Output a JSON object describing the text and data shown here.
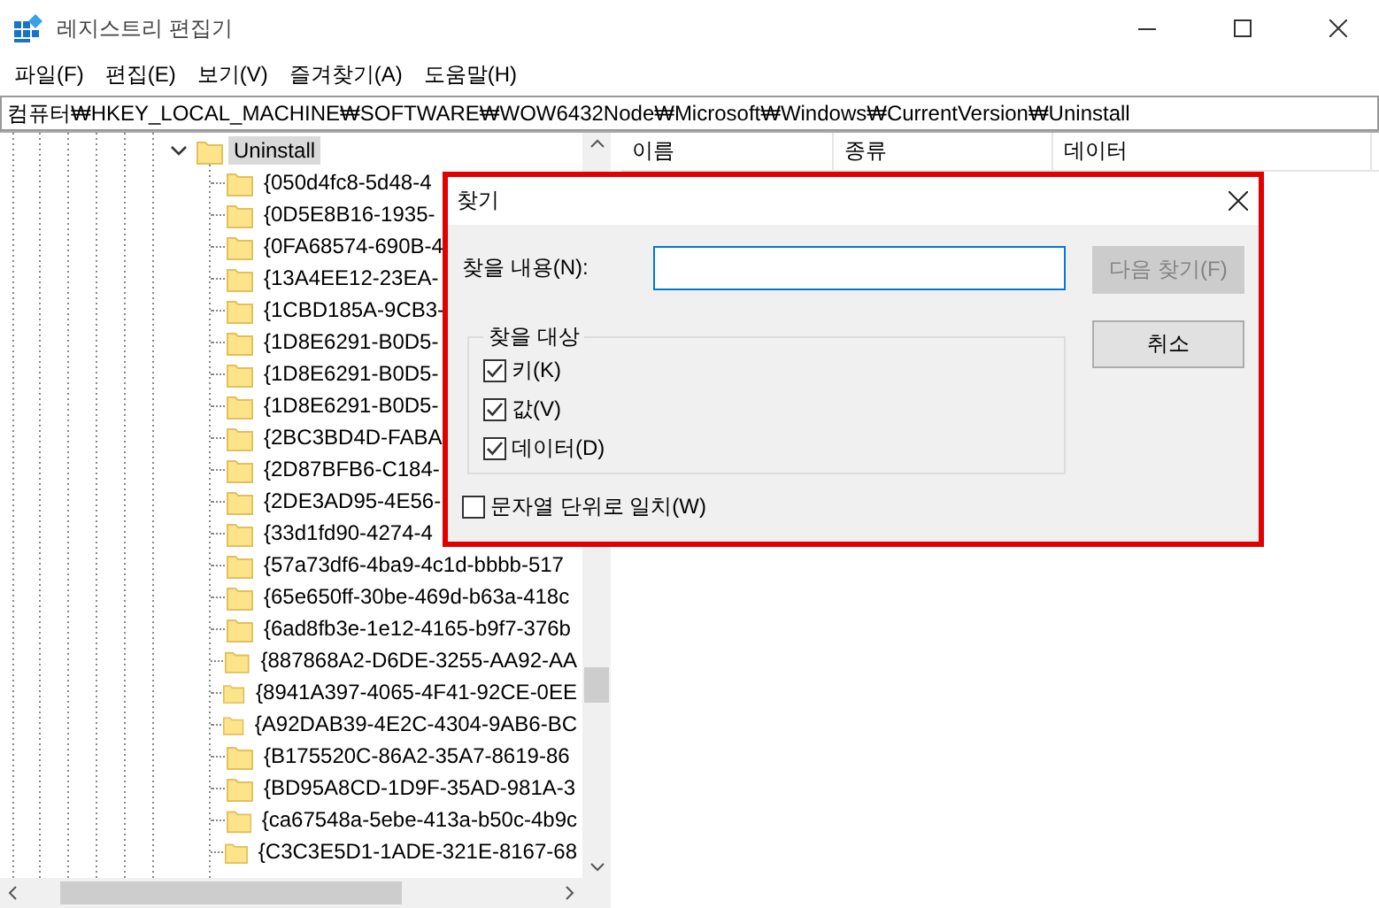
{
  "window": {
    "title": "레지스트리 편집기"
  },
  "menu": [
    {
      "label": "파일(F)"
    },
    {
      "label": "편집(E)"
    },
    {
      "label": "보기(V)"
    },
    {
      "label": "즐겨찾기(A)"
    },
    {
      "label": "도움말(H)"
    }
  ],
  "address": "컴퓨터₩HKEY_LOCAL_MACHINE₩SOFTWARE₩WOW6432Node₩Microsoft₩Windows₩CurrentVersion₩Uninstall",
  "tree": {
    "label": "Uninstall",
    "expanded": true,
    "selected": true,
    "children": [
      {
        "label": "{050d4fc8-5d48-4"
      },
      {
        "label": "{0D5E8B16-1935-"
      },
      {
        "label": "{0FA68574-690B-4"
      },
      {
        "label": "{13A4EE12-23EA-"
      },
      {
        "label": "{1CBD185A-9CB3-"
      },
      {
        "label": "{1D8E6291-B0D5-"
      },
      {
        "label": "{1D8E6291-B0D5-"
      },
      {
        "label": "{1D8E6291-B0D5-"
      },
      {
        "label": "{2BC3BD4D-FABA"
      },
      {
        "label": "{2D87BFB6-C184-"
      },
      {
        "label": "{2DE3AD95-4E56-"
      },
      {
        "label": "{33d1fd90-4274-4"
      },
      {
        "label": "{57a73df6-4ba9-4c1d-bbbb-517"
      },
      {
        "label": "{65e650ff-30be-469d-b63a-418c"
      },
      {
        "label": "{6ad8fb3e-1e12-4165-b9f7-376b"
      },
      {
        "label": "{887868A2-D6DE-3255-AA92-AA"
      },
      {
        "label": "{8941A397-4065-4F41-92CE-0EE"
      },
      {
        "label": "{A92DAB39-4E2C-4304-9AB6-BC"
      },
      {
        "label": "{B175520C-86A2-35A7-8619-86"
      },
      {
        "label": "{BD95A8CD-1D9F-35AD-981A-3"
      },
      {
        "label": "{ca67548a-5ebe-413a-b50c-4b9c"
      },
      {
        "label": "{C3C3E5D1-1ADE-321E-8167-68"
      }
    ]
  },
  "columns": [
    {
      "label": "이름"
    },
    {
      "label": "종류"
    },
    {
      "label": "데이터"
    }
  ],
  "dialog": {
    "title": "찾기",
    "find_label": "찾을 내용(N):",
    "buttons": [
      {
        "label": "다음 찾기(F)",
        "disabled": true
      },
      {
        "label": "취소",
        "disabled": false
      }
    ],
    "group": {
      "title": "찾을 대상",
      "options": [
        {
          "label": "키(K)",
          "checked": true
        },
        {
          "label": "값(V)",
          "checked": true
        },
        {
          "label": "데이터(D)",
          "checked": true
        }
      ]
    },
    "whole_string": {
      "label": "문자열 단위로 일치(W)",
      "checked": false
    }
  }
}
